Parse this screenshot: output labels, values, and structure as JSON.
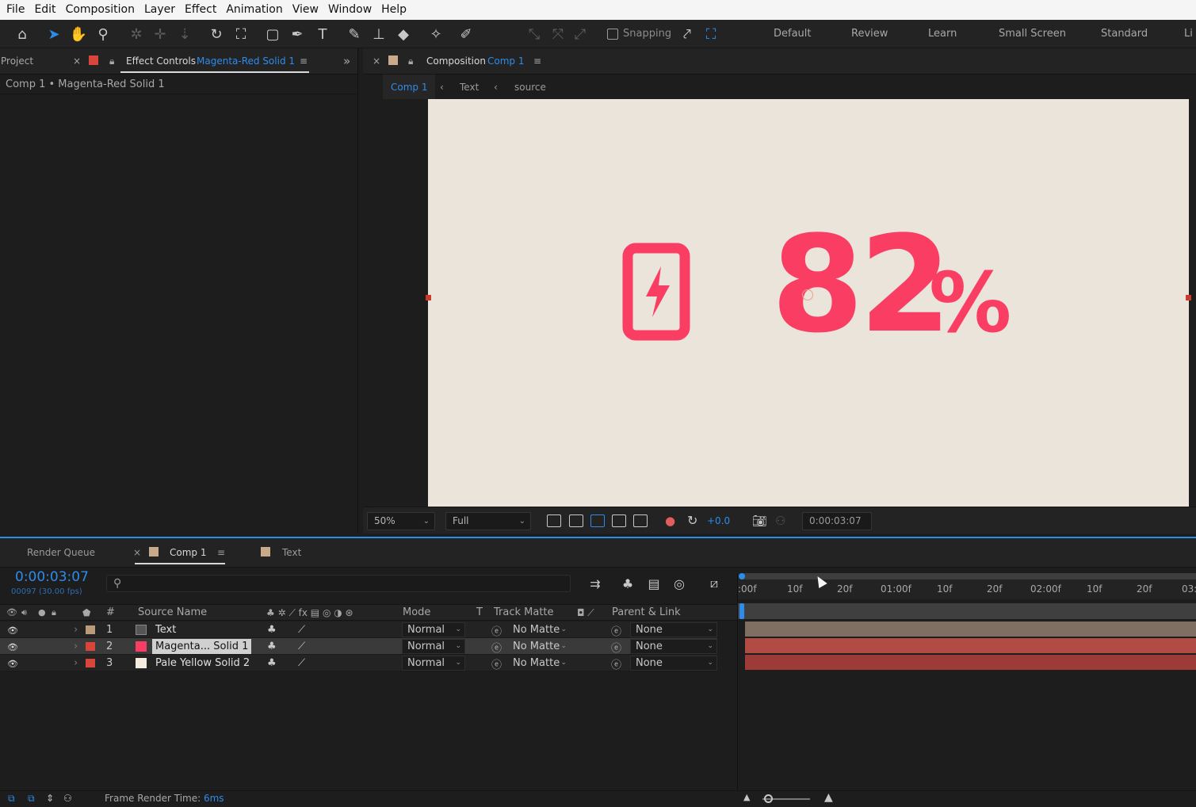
{
  "menu": [
    "File",
    "Edit",
    "Composition",
    "Layer",
    "Effect",
    "Animation",
    "View",
    "Window",
    "Help"
  ],
  "toolbar": {
    "snapping_label": "Snapping",
    "workspaces": [
      "Default",
      "Review",
      "Learn",
      "Small Screen",
      "Standard",
      "Li"
    ]
  },
  "left_panel": {
    "project_tab": "Project",
    "effect_controls_label": "Effect Controls",
    "effect_controls_target": "Magenta-Red Solid 1",
    "subtitle": "Comp 1 • Magenta-Red Solid 1"
  },
  "comp_panel": {
    "tab_label": "Composition",
    "tab_target": "Comp 1",
    "breadcrumbs": [
      "Comp 1",
      "Text",
      "source"
    ],
    "canvas": {
      "background_color": "#ebe4da",
      "accent_color": "#fa3d62",
      "number": "82",
      "percent_sign": "%"
    },
    "viewer_bar": {
      "zoom": "50%",
      "resolution": "Full",
      "exposure": "+0.0",
      "timecode": "0:00:03:07"
    }
  },
  "timeline": {
    "tabs": [
      "Render Queue",
      "Comp 1",
      "Text"
    ],
    "timecode": "0:00:03:07",
    "frame_info": "00097 (30.00 fps)",
    "search_placeholder": "",
    "columns": {
      "number": "#",
      "source_name": "Source Name",
      "mode": "Mode",
      "t": "T",
      "track_matte": "Track Matte",
      "parent_link": "Parent & Link"
    },
    "layers": [
      {
        "num": "1",
        "name": "Text",
        "mode": "Normal",
        "matte": "No Matte",
        "parent": "None",
        "label_color": "#b99a7a",
        "bar_color": "#7e6f62",
        "selected": false
      },
      {
        "num": "2",
        "name": "Magenta... Solid 1",
        "mode": "Normal",
        "matte": "No Matte",
        "parent": "None",
        "label_color": "#d8453a",
        "bar_color": "#b24b44",
        "selected": true
      },
      {
        "num": "3",
        "name": "Pale Yellow Solid 2",
        "mode": "Normal",
        "matte": "No Matte",
        "parent": "None",
        "label_color": "#d8453a",
        "bar_color": "#9c3b37",
        "selected": false
      }
    ],
    "ruler_ticks": [
      ":00f",
      "10f",
      "20f",
      "01:00f",
      "10f",
      "20f",
      "02:00f",
      "10f",
      "20f",
      "03:"
    ],
    "footer_label": "Frame Render Time:",
    "footer_value": "6ms"
  }
}
